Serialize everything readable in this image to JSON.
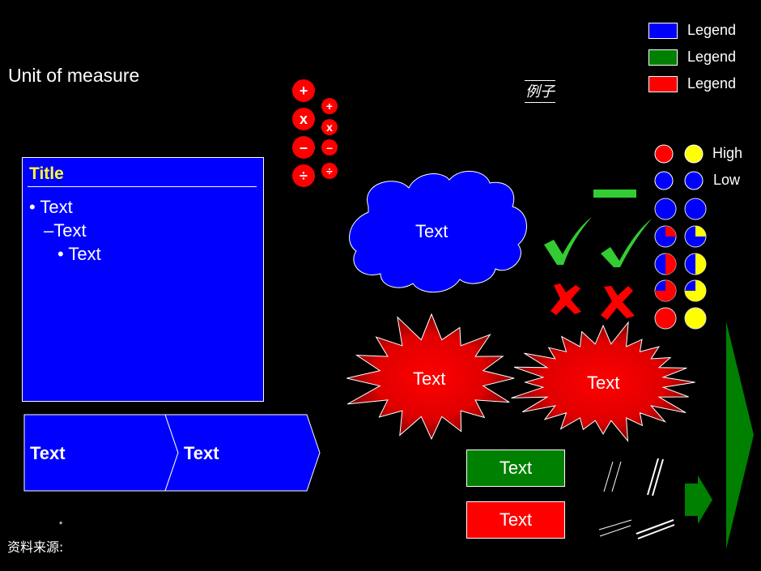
{
  "slide": {
    "unit_of_measure": "Unit of measure",
    "example_label": "例子",
    "source_label": "资料来源:",
    "footnote_marker": "*"
  },
  "text_box": {
    "title": "Title",
    "bullets": [
      "• Text",
      "–Text",
      "• Text"
    ]
  },
  "operators": {
    "large": [
      "+",
      "x",
      "–",
      "÷"
    ],
    "small": [
      "+",
      "x",
      "–",
      "÷"
    ],
    "color": "#ff0000"
  },
  "legend": {
    "items": [
      {
        "label": "Legend",
        "color": "#0000ff"
      },
      {
        "label": "Legend",
        "color": "#008000"
      },
      {
        "label": "Legend",
        "color": "#ff0000"
      }
    ]
  },
  "harvey_balls": {
    "high_label": "High",
    "low_label": "Low",
    "columns": [
      {
        "fill_color": "#ff0000",
        "levels": [
          0,
          0.25,
          0.5,
          0.75,
          1
        ]
      },
      {
        "fill_color": "#ffff00",
        "levels": [
          0,
          0.25,
          0.5,
          0.75,
          1
        ]
      }
    ],
    "base_color": "#0000ff"
  },
  "shapes": {
    "cloud_text": "Text",
    "burst1_text": "Text",
    "burst2_text": "Text",
    "chevron1_text": "Text",
    "chevron2_text": "Text",
    "green_box_text": "Text",
    "red_box_text": "Text"
  },
  "colors": {
    "blue": "#0000ff",
    "green": "#008000",
    "red": "#ff0000",
    "yellow": "#ffff00",
    "check_green": "#33cc33"
  }
}
